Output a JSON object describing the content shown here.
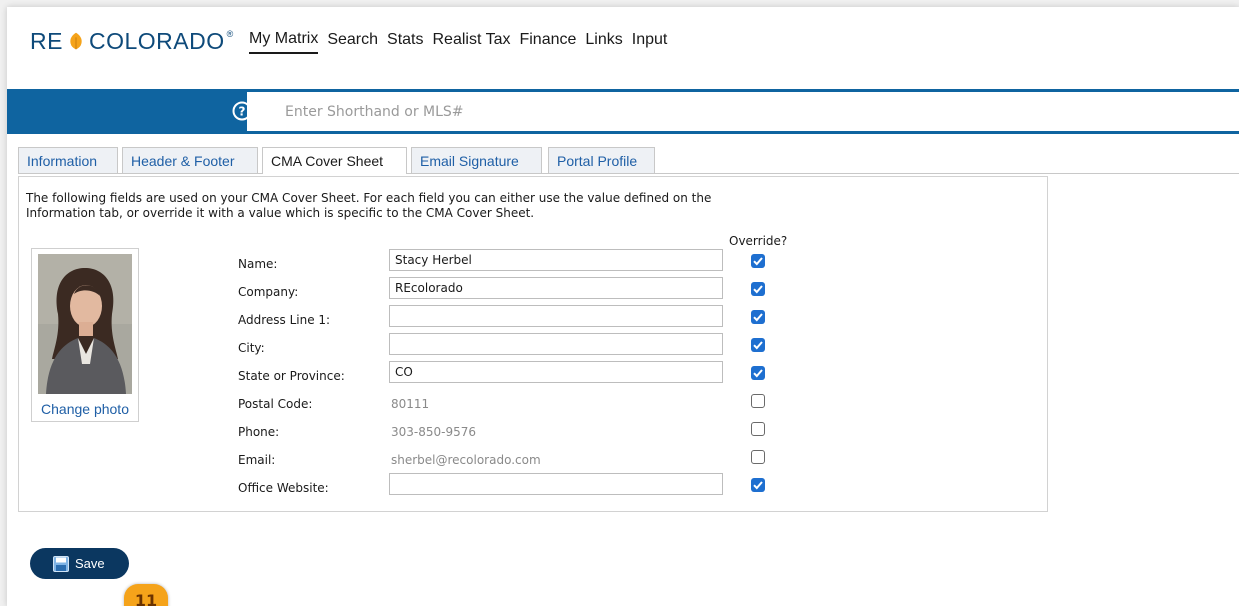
{
  "brand": {
    "logo_left": "RE",
    "logo_right": "COLORADO",
    "trademark": "®",
    "leaf_color": "#f5a31a",
    "primary": "#0e4a7a"
  },
  "nav": [
    {
      "label": "My Matrix",
      "active": true
    },
    {
      "label": "Search"
    },
    {
      "label": "Stats"
    },
    {
      "label": "Realist Tax"
    },
    {
      "label": "Finance"
    },
    {
      "label": "Links"
    },
    {
      "label": "Input"
    }
  ],
  "search": {
    "placeholder": "Enter Shorthand or MLS#",
    "value": "",
    "icon": "help-circle-icon",
    "bar_color": "#0f64a0"
  },
  "tabs": [
    {
      "label": "Information"
    },
    {
      "label": "Header & Footer"
    },
    {
      "label": "CMA Cover Sheet",
      "active": true
    },
    {
      "label": "Email Signature"
    },
    {
      "label": "Portal Profile"
    }
  ],
  "intro": "The following fields are used on your CMA Cover Sheet. For each field you can either use the value defined on the Information tab, or override it with a value which is specific to the CMA Cover Sheet.",
  "override_header": "Override?",
  "photo": {
    "change_label": "Change photo"
  },
  "fields": [
    {
      "label": "Name:",
      "value": "Stacy Herbel",
      "editable": true,
      "override": true
    },
    {
      "label": "Company:",
      "value": "REcolorado",
      "editable": true,
      "override": true
    },
    {
      "label": "Address Line 1:",
      "value": "",
      "editable": true,
      "override": true
    },
    {
      "label": "City:",
      "value": "",
      "editable": true,
      "override": true
    },
    {
      "label": "State or Province:",
      "value": "CO",
      "editable": true,
      "override": true
    },
    {
      "label": "Postal Code:",
      "value": "80111",
      "editable": false,
      "override": false
    },
    {
      "label": "Phone:",
      "value": "303-850-9576",
      "editable": false,
      "override": false
    },
    {
      "label": "Email:",
      "value": "sherbel@recolorado.com",
      "editable": false,
      "override": false
    },
    {
      "label": "Office Website:",
      "value": "",
      "editable": true,
      "override": true
    }
  ],
  "save": {
    "label": "Save",
    "icon": "floppy-disk-icon"
  },
  "callout": {
    "number": "11",
    "color": "#f5a31a"
  }
}
